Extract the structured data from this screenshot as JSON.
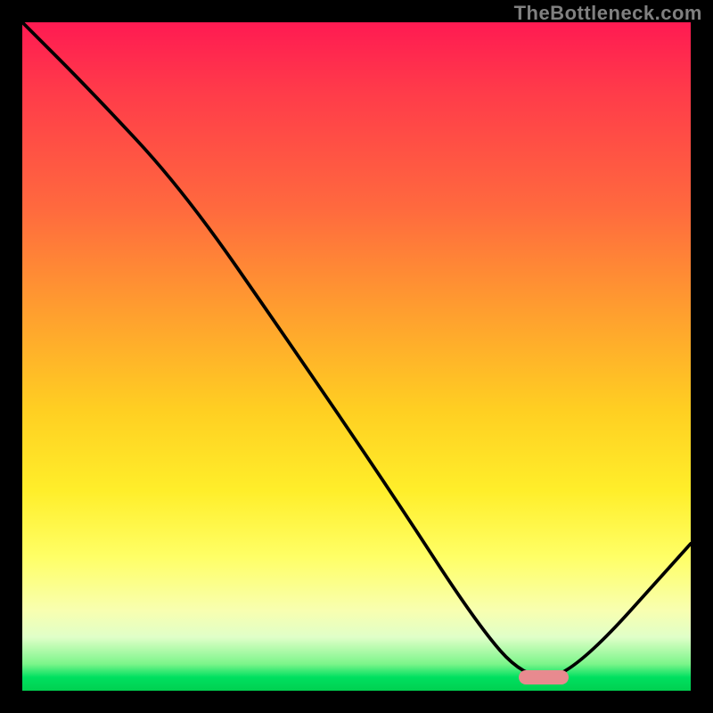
{
  "watermark": "TheBottleneck.com",
  "chart_data": {
    "type": "line",
    "title": "",
    "xlabel": "",
    "ylabel": "",
    "xlim": [
      0,
      100
    ],
    "ylim": [
      0,
      100
    ],
    "grid": false,
    "series": [
      {
        "name": "bottleneck-curve",
        "x": [
          0,
          10,
          24,
          40,
          55,
          68,
          75,
          82,
          100
        ],
        "y": [
          100,
          90,
          75,
          52,
          30,
          10,
          2,
          2,
          22
        ]
      }
    ],
    "marker": {
      "x": 78,
      "y": 2,
      "color": "#e88a8f"
    },
    "background_gradient": {
      "stops": [
        {
          "pos": 0,
          "color": "#ff1a52"
        },
        {
          "pos": 28,
          "color": "#ff6a3e"
        },
        {
          "pos": 58,
          "color": "#ffcf22"
        },
        {
          "pos": 80,
          "color": "#ffff66"
        },
        {
          "pos": 96,
          "color": "#7cf58a"
        },
        {
          "pos": 100,
          "color": "#00d050"
        }
      ]
    }
  }
}
